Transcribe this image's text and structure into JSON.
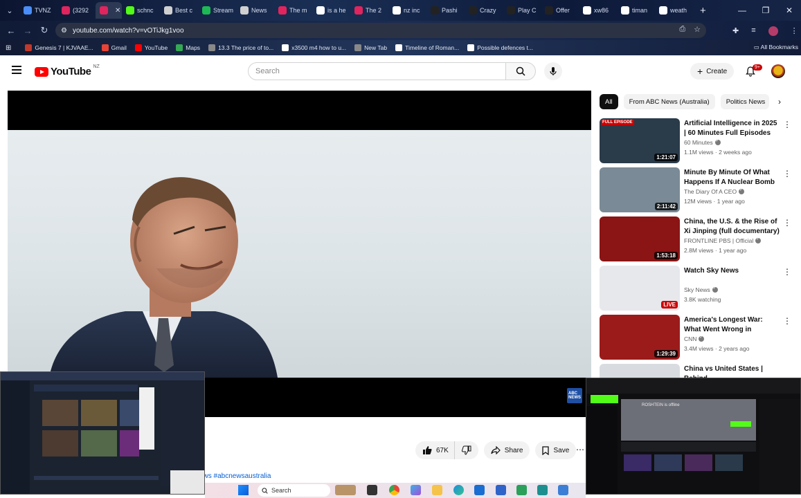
{
  "browser": {
    "tabs": [
      {
        "label": "TVNZ",
        "color": "#4a8df8"
      },
      {
        "label": "(3292",
        "color": "#e0245e"
      },
      {
        "label": "",
        "color": "#e0245e"
      },
      {
        "label": "schnc",
        "color": "#53fc18"
      },
      {
        "label": "Best c",
        "color": "#d0d0d0"
      },
      {
        "label": "Stream",
        "color": "#1db954"
      },
      {
        "label": "News",
        "color": "#d0d0d0"
      },
      {
        "label": "The m",
        "color": "#e0245e"
      },
      {
        "label": "is a he",
        "color": "#ffffff"
      },
      {
        "label": "The 2",
        "color": "#e0245e"
      },
      {
        "label": "nz inc",
        "color": "#ffffff"
      },
      {
        "label": "Pashi",
        "color": "#222222"
      },
      {
        "label": "Crazy",
        "color": "#222222"
      },
      {
        "label": "Play C",
        "color": "#222222"
      },
      {
        "label": "Offer",
        "color": "#222222"
      },
      {
        "label": "xw86",
        "color": "#ffffff"
      },
      {
        "label": "timan",
        "color": "#ffffff"
      },
      {
        "label": "weath",
        "color": "#ffffff"
      }
    ],
    "url": "youtube.com/watch?v=vOTiJkg1voo",
    "bookmarks": [
      {
        "label": "Genesis 7 | KJVAAE...",
        "color": "#c0392b"
      },
      {
        "label": "Gmail",
        "color": "#ea4335"
      },
      {
        "label": "YouTube",
        "color": "#ff0000"
      },
      {
        "label": "Maps",
        "color": "#34a853"
      },
      {
        "label": "13.3 The price of to...",
        "color": "#888888"
      },
      {
        "label": "x3500 m4 how to u...",
        "color": "#ffffff"
      },
      {
        "label": "New Tab",
        "color": "#888888"
      },
      {
        "label": "Timeline of Roman...",
        "color": "#ffffff"
      },
      {
        "label": "Possible defences t...",
        "color": "#ffffff"
      }
    ],
    "all_bookmarks": "All Bookmarks"
  },
  "youtube": {
    "logo_text": "YouTube",
    "region": "NZ",
    "search_placeholder": "Search",
    "create_label": "Create",
    "notif_count": "9+",
    "chips": [
      "All",
      "From ABC News (Australia)",
      "Politics News"
    ],
    "likes": "67K",
    "share_label": "Share",
    "save_label": "Save",
    "description_tags": "ews #abcnewsaustralia",
    "recommendations": [
      {
        "title": "Artificial Intelligence in 2025 | 60 Minutes Full Episodes",
        "channel": "60 Minutes",
        "meta": "1.1M views · 2 weeks ago",
        "duration": "1:21:07",
        "badge": "FULL EPISODE",
        "thumb": "#2a3b4a"
      },
      {
        "title": "Minute By Minute Of What Happens If A Nuclear Bomb ...",
        "channel": "The Diary Of A CEO",
        "meta": "12M views · 1 year ago",
        "duration": "2:11:42",
        "badge": "",
        "thumb": "#7a8a96"
      },
      {
        "title": "China, the U.S. & the Rise of Xi Jinping (full documentary) | ...",
        "channel": "FRONTLINE PBS | Official",
        "meta": "2.8M views · 1 year ago",
        "duration": "1:53:18",
        "badge": "",
        "thumb": "#8b1414"
      },
      {
        "title": "Watch Sky News",
        "channel": "Sky News",
        "meta": "3.8K watching",
        "duration": "LIVE",
        "badge": "",
        "thumb": "#e6e8ec"
      },
      {
        "title": "America's Longest War: What Went Wrong in Afghanistan ...",
        "channel": "CNN",
        "meta": "3.4M views · 2 years ago",
        "duration": "1:29:39",
        "badge": "",
        "thumb": "#9b1b1b"
      },
      {
        "title": "China vs United States | Behind",
        "channel": "",
        "meta": "",
        "duration": "",
        "badge": "",
        "thumb": "#d8dce0"
      }
    ]
  },
  "taskbar": {
    "search_label": "Search"
  },
  "overlays": {
    "pip_right_text": "ROSHTEIN is offline"
  }
}
